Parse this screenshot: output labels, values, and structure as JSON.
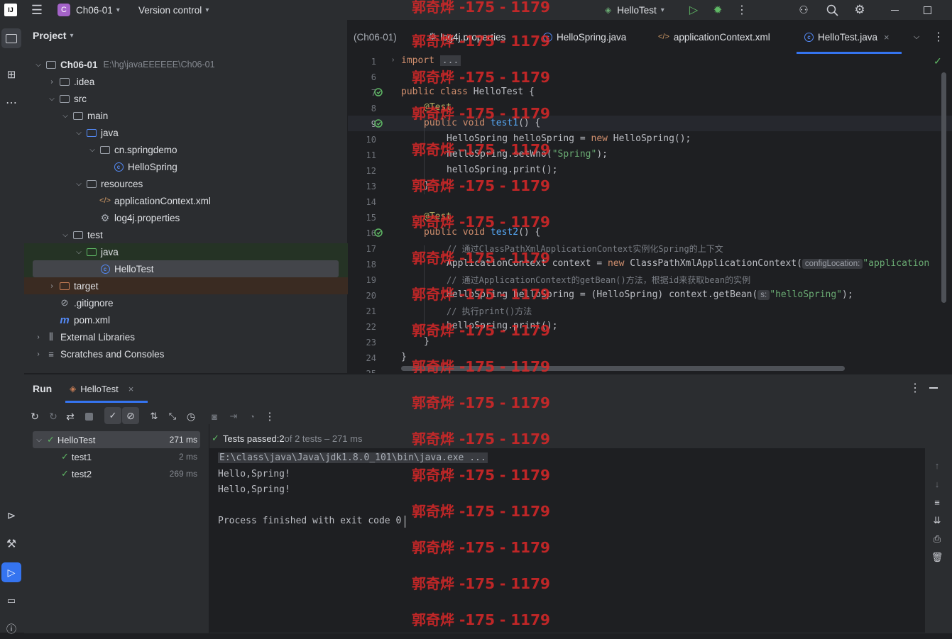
{
  "titlebar": {
    "project_badge": "C",
    "project_name": "Ch06-01",
    "vcs": "Version control",
    "run_config": "HelloTest"
  },
  "project_panel": {
    "title": "Project",
    "rows": [
      {
        "label": "Ch06-01",
        "path": "E:\\hg\\javaEEEEEE\\Ch06-01"
      },
      {
        "label": ".idea"
      },
      {
        "label": "src"
      },
      {
        "label": "main"
      },
      {
        "label": "java"
      },
      {
        "label": "cn.springdemo"
      },
      {
        "label": "HelloSpring"
      },
      {
        "label": "resources"
      },
      {
        "label": "applicationContext.xml"
      },
      {
        "label": "log4j.properties"
      },
      {
        "label": "test"
      },
      {
        "label": "java"
      },
      {
        "label": "HelloTest"
      },
      {
        "label": "target"
      },
      {
        "label": ".gitignore"
      },
      {
        "label": "pom.xml"
      },
      {
        "label": "External Libraries"
      },
      {
        "label": "Scratches and Consoles"
      }
    ]
  },
  "editor_tabs": [
    {
      "label": "(Ch06-01)"
    },
    {
      "label": "log4j.properties"
    },
    {
      "label": "HelloSpring.java"
    },
    {
      "label": "applicationContext.xml"
    },
    {
      "label": "HelloTest.java"
    }
  ],
  "editor": {
    "line_numbers": [
      "1",
      "6",
      "7",
      "8",
      "9",
      "10",
      "11",
      "12",
      "13",
      "14",
      "15",
      "16",
      "17",
      "18",
      "19",
      "20",
      "21",
      "22",
      "23",
      "24",
      "25"
    ],
    "lines": {
      "l1_kw": "import",
      "l1_fold": "...",
      "l7": "public class HelloTest {",
      "l8": "@Test",
      "l9_pre": "public void ",
      "l9_fn": "test1",
      "l9_post": "() {",
      "l10_a": "HelloSpring helloSpring = ",
      "l10_kw": "new",
      "l10_b": " HelloSpring();",
      "l11_a": "helloSpring.setWho(",
      "l11_str": "\"Spring\"",
      "l11_b": ");",
      "l12": "helloSpring.print();",
      "l13": "}",
      "l15": "@Test",
      "l16_pre": "public void ",
      "l16_fn": "test2",
      "l16_post": "() {",
      "l17": "// 通过ClassPathXmlApplicationContext实例化Spring的上下文",
      "l18_a": "ApplicationContext context = ",
      "l18_kw": "new",
      "l18_b": " ClassPathXmlApplicationContext(",
      "l18_hint": "configLocation:",
      "l18_str": "\"application",
      "l19": "// 通过ApplicationContext的getBean()方法，根据id来获取bean的实例",
      "l20_a": "HelloSpring helloSpring = (HelloSpring) context.getBean(",
      "l20_hint": "s:",
      "l20_str": "\"helloSpring\"",
      "l20_b": ");",
      "l21": "// 执行print()方法",
      "l22": "helloSpring.print();",
      "l23": "}",
      "l24": "}"
    }
  },
  "run_panel": {
    "title": "Run",
    "tab": "HelloTest",
    "tests": [
      {
        "name": "HelloTest",
        "time": "271 ms"
      },
      {
        "name": "test1",
        "time": "2 ms"
      },
      {
        "name": "test2",
        "time": "269 ms"
      }
    ],
    "status_prefix": "Tests passed: ",
    "status_count": "2",
    "status_suffix": " of 2 tests – 271 ms",
    "console": [
      "E:\\class\\java\\Java\\jdk1.8.0_101\\bin\\java.exe ...",
      "Hello,Spring!",
      "Hello,Spring!",
      "",
      "Process finished with exit code 0"
    ]
  },
  "watermark": "郭奇烨 -175 - 1179"
}
